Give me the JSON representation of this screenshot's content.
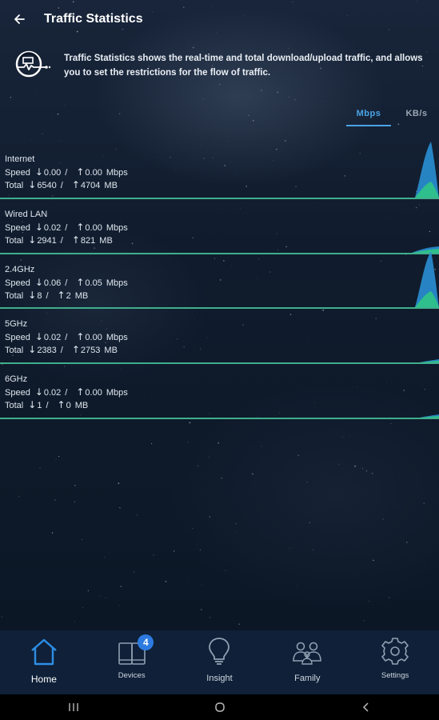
{
  "header": {
    "title": "Traffic Statistics"
  },
  "intro": {
    "text": "Traffic Statistics shows the real-time and total download/upload traffic, and allows you to set the restrictions for the flow of traffic."
  },
  "units": {
    "active": "Mbps",
    "inactive": "KB/s"
  },
  "interfaces": [
    {
      "name": "Internet",
      "speed_label": "Speed",
      "speed_down": "0.00",
      "speed_up": "0.00",
      "speed_unit": "Mbps",
      "total_label": "Total",
      "total_down": "6540",
      "total_up": "4704",
      "total_unit": "MB",
      "spark": "large"
    },
    {
      "name": "Wired LAN",
      "speed_label": "Speed",
      "speed_down": "0.02",
      "speed_up": "0.00",
      "speed_unit": "Mbps",
      "total_label": "Total",
      "total_down": "2941",
      "total_up": "821",
      "total_unit": "MB",
      "spark": "small"
    },
    {
      "name": "2.4GHz",
      "speed_label": "Speed",
      "speed_down": "0.06",
      "speed_up": "0.05",
      "speed_unit": "Mbps",
      "total_label": "Total",
      "total_down": "8",
      "total_up": "2",
      "total_unit": "MB",
      "spark": "large"
    },
    {
      "name": "5GHz",
      "speed_label": "Speed",
      "speed_down": "0.02",
      "speed_up": "0.00",
      "speed_unit": "Mbps",
      "total_label": "Total",
      "total_down": "2383",
      "total_up": "2753",
      "total_unit": "MB",
      "spark": "tiny"
    },
    {
      "name": "6GHz",
      "speed_label": "Speed",
      "speed_down": "0.02",
      "speed_up": "0.00",
      "speed_unit": "Mbps",
      "total_label": "Total",
      "total_down": "1",
      "total_up": "0",
      "total_unit": "MB",
      "spark": "tiny"
    }
  ],
  "nav": {
    "items": [
      {
        "label": "Home",
        "icon": "home-icon",
        "active": true
      },
      {
        "label": "Devices",
        "icon": "devices-icon",
        "badge": "4"
      },
      {
        "label": "Insight",
        "icon": "lightbulb-icon"
      },
      {
        "label": "Family",
        "icon": "family-icon"
      },
      {
        "label": "Settings",
        "icon": "gear-icon"
      }
    ]
  },
  "colors": {
    "accent": "#4aa3e6",
    "line": "#3fae8c",
    "download_fill": "#2a8fd4",
    "upload_fill": "#2ec28a",
    "nav_bg": "#0f2038"
  }
}
